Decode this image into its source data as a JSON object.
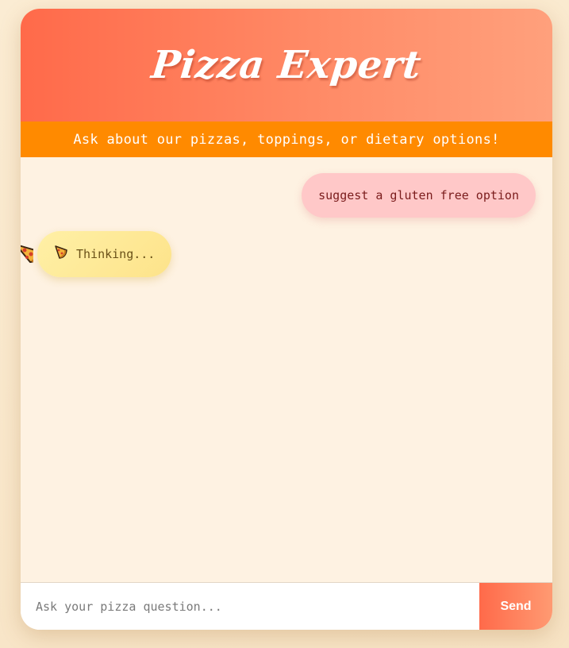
{
  "header": {
    "title": "Pizza Expert",
    "subtitle": "Ask about our pizzas, toppings, or dietary options!"
  },
  "chat": {
    "messages": [
      {
        "role": "user",
        "text": "suggest a gluten free option"
      },
      {
        "role": "bot",
        "text": "Thinking...",
        "icon": "pizza-slice-icon"
      }
    ]
  },
  "composer": {
    "placeholder": "Ask your pizza question...",
    "value": "",
    "send_label": "Send"
  },
  "colors": {
    "header_gradient_start": "#ff6a4a",
    "header_gradient_end": "#ffa07c",
    "subtitle_bar": "#ff8a00",
    "chat_background": "#fef2e2",
    "user_bubble": "#ffc8c8",
    "bot_bubble": "#fde38a"
  }
}
